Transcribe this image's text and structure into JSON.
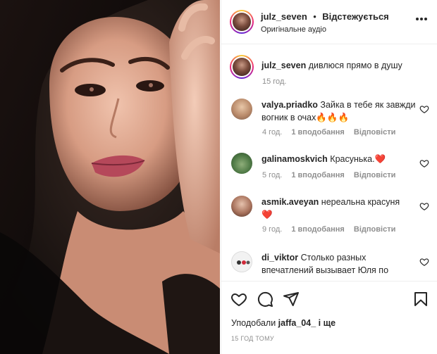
{
  "header": {
    "username": "julz_seven",
    "separator": "•",
    "follow_status": "Відстежується",
    "audio": "Оригінальне аудіо"
  },
  "caption": {
    "username": "julz_seven",
    "text": "дивлюся прямо в душу",
    "time": "15 год."
  },
  "comments": [
    {
      "username": "valya.priadko",
      "text": "Зайка в тебе як завжди вогник в очах🔥🔥🔥",
      "time": "4 год.",
      "likes": "1 вподобання",
      "reply": "Відповісти"
    },
    {
      "username": "galinamoskvich",
      "text": "Красунька.❤️",
      "time": "5 год.",
      "likes": "1 вподобання",
      "reply": "Відповісти"
    },
    {
      "username": "asmik.aveyan",
      "text": "нереальна красуня ❤️",
      "time": "9 год.",
      "likes": "1 вподобання",
      "reply": "Відповісти"
    },
    {
      "username": "di_viktor",
      "text": "Столько разных впечатлений вызывает Юля по",
      "time": "",
      "likes": "",
      "reply": ""
    }
  ],
  "footer": {
    "liked_by_prefix": "Уподобали",
    "liked_by_user": "jaffa_04_",
    "liked_by_suffix": "і ще",
    "time_ago": "15 ГОД ТОМУ"
  },
  "icons": {
    "more": "more-horizontal-icon",
    "like": "heart-icon",
    "comment": "comment-bubble-icon",
    "share": "paper-plane-icon",
    "save": "bookmark-icon"
  },
  "colors": {
    "text": "#262626",
    "muted": "#8e8e8e",
    "border": "#efefef"
  }
}
